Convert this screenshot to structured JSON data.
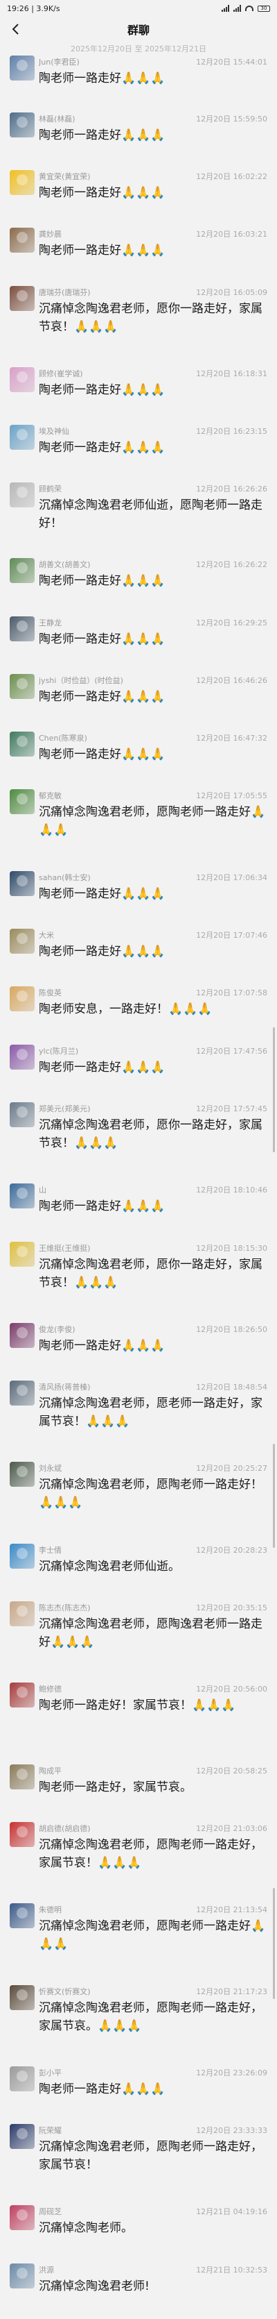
{
  "status": {
    "time": "19:26",
    "speed": "3.9K/s",
    "battery": "30"
  },
  "header": {
    "title": "群聊"
  },
  "date_range": "2025年12月20日 至 2025年12月21日",
  "colors": {
    "background": "#f2f2f2",
    "text": "#1b1b1b",
    "meta": "#999999"
  },
  "messages": [
    {
      "sender": "Jun(李君臣)",
      "time": "12月20日 15:44:01",
      "text": "陶老师一路走好🙏🙏🙏",
      "avatar_color": "#5f7fa8",
      "avatar_icon": "person-photo"
    },
    {
      "sender": "林磊(林磊)",
      "time": "12月20日 15:59:50",
      "text": "陶老师一路走好🙏🙏🙏",
      "avatar_color": "#4d6d8a",
      "avatar_icon": "person-photo"
    },
    {
      "sender": "黄宜荣(黄宜荣)",
      "time": "12月20日 16:02:22",
      "text": "陶老师一路走好🙏🙏🙏",
      "avatar_color": "#f0c020",
      "avatar_icon": "duck-photo"
    },
    {
      "sender": "龚妙晨",
      "time": "12月20日 16:03:21",
      "text": "陶老师一路走好🙏🙏🙏",
      "avatar_color": "#8a6a4a",
      "avatar_icon": "person-photo"
    },
    {
      "sender": "唐瑞芬(唐瑞芬)",
      "time": "12月20日 16:05:09",
      "text": "沉痛悼念陶逸君老师，愿你一路走好，家属节哀！🙏🙏🙏",
      "avatar_color": "#7a4f3e",
      "avatar_icon": "person-photo"
    },
    {
      "sender": "顾修(崔学诚)",
      "time": "12月20日 16:18:31",
      "text": "陶老师一路走好🙏🙏🙏",
      "avatar_color": "#d9a0c8",
      "avatar_icon": "cartoon-photo"
    },
    {
      "sender": "埃及神仙",
      "time": "12月20日 16:23:15",
      "text": "陶老师一路走好🙏🙏🙏",
      "avatar_color": "#6aa2c8",
      "avatar_icon": "sky-photo"
    },
    {
      "sender": "顾鹤荣",
      "time": "12月20日 16:26:26",
      "text": "沉痛悼念陶逸君老师仙逝，愿陶老师一路走好！",
      "avatar_color": "#b8b8b8",
      "avatar_icon": "person-photo"
    },
    {
      "sender": "胡善文(胡善文)",
      "time": "12月20日 16:26:22",
      "text": "陶老师一路走好🙏🙏🙏",
      "avatar_color": "#5e8a55",
      "avatar_icon": "landscape-photo"
    },
    {
      "sender": "王静龙",
      "time": "12月20日 16:29:25",
      "text": "陶老师一路走好🙏🙏🙏",
      "avatar_color": "#4a5a6a",
      "avatar_icon": "person-photo"
    },
    {
      "sender": "jyshi（时俭益）(时俭益)",
      "time": "12月20日 16:46:26",
      "text": "陶老师一路走好🙏🙏🙏",
      "avatar_color": "#6c8f4e",
      "avatar_icon": "landscape-photo"
    },
    {
      "sender": "Chen(陈寒泉)",
      "time": "12月20日 16:47:32",
      "text": "陶老师一路走好🙏🙏🙏",
      "avatar_color": "#3f7a5f",
      "avatar_icon": "plant-photo"
    },
    {
      "sender": "郁克敏",
      "time": "12月20日 17:05:55",
      "text": "沉痛悼念陶逸君老师，愿陶老师一路走好🙏🙏🙏",
      "avatar_color": "#4d8a3f",
      "avatar_icon": "plant-photo"
    },
    {
      "sender": "sahan(韩士安)",
      "time": "12月20日 17:06:34",
      "text": "陶老师一路走好🙏🙏🙏",
      "avatar_color": "#2e4a6a",
      "avatar_icon": "person-photo"
    },
    {
      "sender": "大米",
      "time": "12月20日 17:07:46",
      "text": "陶老师一路走好🙏🙏🙏",
      "avatar_color": "#9a8a5a",
      "avatar_icon": "landscape-photo"
    },
    {
      "sender": "陈俊英",
      "time": "12月20日 17:07:58",
      "text": "陶老师安息，一路走好！🙏🙏🙏",
      "avatar_color": "#d8a860",
      "avatar_icon": "flower-photo"
    },
    {
      "sender": "ylc(陈月兰)",
      "time": "12月20日 17:47:56",
      "text": "陶老师一路走好🙏🙏🙏",
      "avatar_color": "#8a5aa8",
      "avatar_icon": "flower-photo"
    },
    {
      "sender": "郑美元(郑美元)",
      "time": "12月20日 17:57:45",
      "text": "沉痛悼念陶逸君老师，愿你一路走好，家属节哀！🙏🙏🙏",
      "avatar_color": "#6a7a8a",
      "avatar_icon": "person-photo"
    },
    {
      "sender": "山",
      "time": "12月20日 18:10:46",
      "text": "陶老师一路走好🙏🙏🙏",
      "avatar_color": "#3a6a9a",
      "avatar_icon": "mountain-photo"
    },
    {
      "sender": "王维挺(王维挺)",
      "time": "12月20日 18:15:30",
      "text": "沉痛悼念陶逸君老师，愿你一路走好，家属节哀！🙏🙏🙏",
      "avatar_color": "#e0c040",
      "avatar_icon": "flower-photo"
    },
    {
      "sender": "俊龙(李俊)",
      "time": "12月20日 18:26:50",
      "text": "陶老师一路走好🙏🙏🙏",
      "avatar_color": "#7a3a6a",
      "avatar_icon": "flower-photo"
    },
    {
      "sender": "清风扬(蒋普榛)",
      "time": "12月20日 18:48:54",
      "text": "沉痛悼念陶逸君老师，愿老师一路走好，家属节哀！🙏🙏🙏",
      "avatar_color": "#5a6a7a",
      "avatar_icon": "landscape-photo"
    },
    {
      "sender": "刘永斌",
      "time": "12月20日 20:25:27",
      "text": "沉痛悼念陶逸君老师，愿陶老师一路走好！🙏🙏🙏",
      "avatar_color": "#4a5a4a",
      "avatar_icon": "landscape-photo"
    },
    {
      "sender": "李士倩",
      "time": "12月20日 20:28:23",
      "text": "沉痛悼念陶逸君老师仙逝。",
      "avatar_color": "#3a8ac8",
      "avatar_icon": "sky-photo"
    },
    {
      "sender": "陈志杰(陈志杰)",
      "time": "12月20日 20:35:15",
      "text": "沉痛悼念陶逸君老师，愿陶逸君老师一路走好🙏🙏🙏",
      "avatar_color": "#c8a888",
      "avatar_icon": "person-photo"
    },
    {
      "sender": "鲍修德",
      "time": "12月20日 20:56:00",
      "text": "陶老师一路走好！家属节哀！🙏🙏🙏",
      "avatar_color": "#a83a3a",
      "avatar_icon": "person-photo"
    },
    {
      "sender": "陶成平",
      "time": "12月20日 20:58:25",
      "text": "陶老师一路走好，家属节哀。",
      "avatar_color": "#8a7a5a",
      "avatar_icon": "landscape-photo"
    },
    {
      "sender": "胡启德(胡启德)",
      "time": "12月20日 21:03:06",
      "text": "沉痛悼念陶逸君老师，愿陶老师一路走好，家属节哀！🙏🙏🙏",
      "avatar_color": "#c83030",
      "avatar_icon": "flag-photo"
    },
    {
      "sender": "朱德明",
      "time": "12月20日 21:13:54",
      "text": "沉痛悼念陶逸君老师，愿陶老师一路走好🙏🙏🙏",
      "avatar_color": "#3a5a8a",
      "avatar_icon": "person-photo"
    },
    {
      "sender": "忻赛文(忻赛文)",
      "time": "12月20日 21:17:23",
      "text": "沉痛悼念陶逸君老师，愿陶老师一路走好，家属节哀。🙏🙏🙏",
      "avatar_color": "#5a4a3a",
      "avatar_icon": "person-photo"
    },
    {
      "sender": "彭小平",
      "time": "12月20日 23:26:09",
      "text": "陶老师一路走好🙏🙏🙏",
      "avatar_color": "#9a9a9a",
      "avatar_icon": "landscape-photo"
    },
    {
      "sender": "阮荣耀",
      "time": "12月20日 23:33:33",
      "text": "沉痛悼念陶逸君老师，愿陶老师一路走好，家属节哀！",
      "avatar_color": "#2a3a6a",
      "avatar_icon": "person-photo"
    },
    {
      "sender": "周砚芝",
      "time": "12月21日 04:19:16",
      "text": "沉痛悼念陶老师。",
      "avatar_color": "#c04060",
      "avatar_icon": "flower-photo"
    },
    {
      "sender": "洪源",
      "time": "12月21日 10:32:53",
      "text": "沉痛悼念陶逸君老师!",
      "avatar_color": "#6a8aa8",
      "avatar_icon": "sky-photo"
    }
  ]
}
